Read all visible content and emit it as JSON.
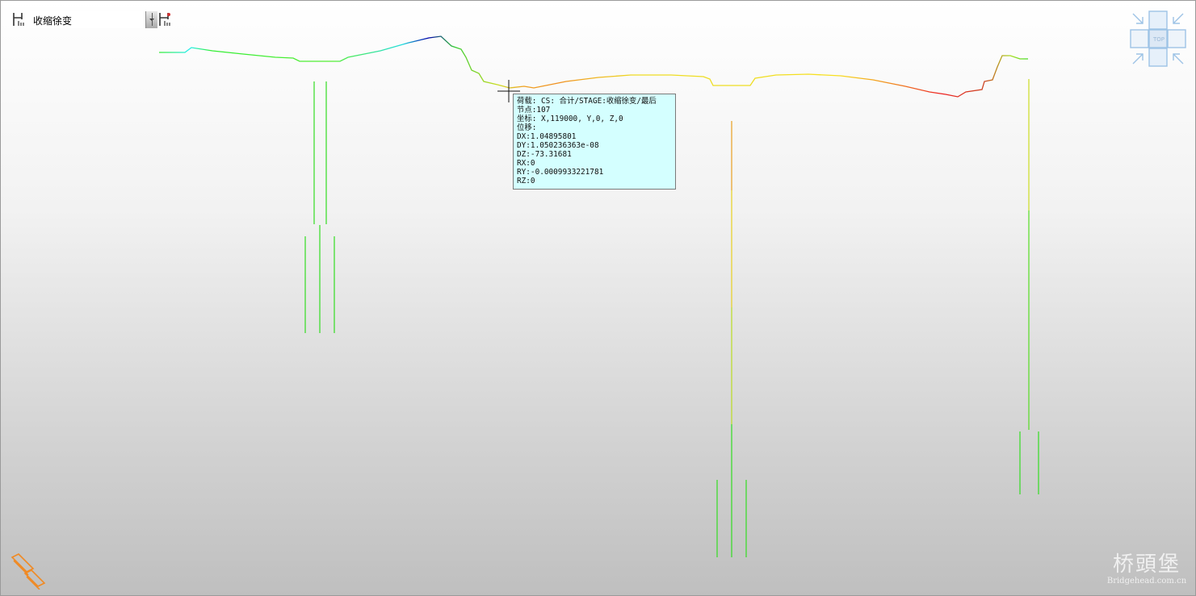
{
  "toolbar": {
    "load_icon": "load-case-icon",
    "combo_value": "收缩徐变",
    "combo_arrow_icon": "chevron-down-icon",
    "result_icon": "result-toggle-icon"
  },
  "tooltip": {
    "lines": [
      "荷载: CS: 合计/STAGE:收缩徐变/最后",
      "节点:107",
      "坐标: X,119000,  Y,0,  Z,0",
      "位移:",
      "DX:1.04895801",
      "DY:1.050236363e-08",
      "DZ:-73.31681",
      "RX:0",
      "RY:-0.0009933221781",
      "RZ:0"
    ]
  },
  "view_cube": {
    "label": "TOP",
    "accent": "#9dc3e6"
  },
  "axis_icon": "axis-indicator-icon",
  "watermark": {
    "title": "桥頭堡",
    "subtitle": "Bridgehead.com.cn"
  },
  "colors": {
    "piers": "#33dd22",
    "tooltip_bg": "#d4ffff",
    "axis_icon": "#f08a24"
  }
}
